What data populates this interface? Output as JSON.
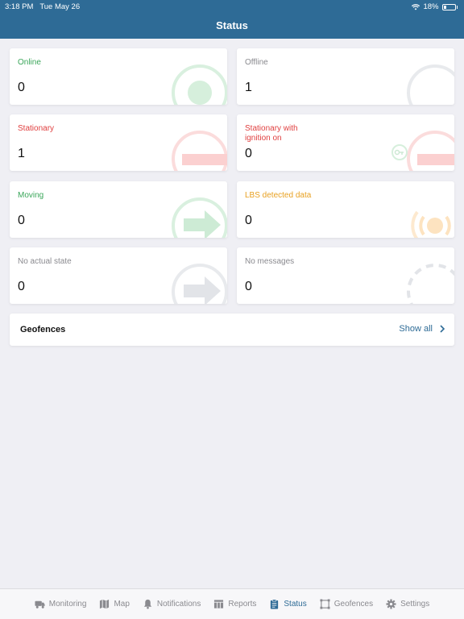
{
  "statusbar": {
    "time": "3:18 PM",
    "date": "Tue May 26",
    "battery": "18%"
  },
  "header": {
    "title": "Status"
  },
  "cards": [
    {
      "label": "Online",
      "value": "0",
      "color": "#3aa65a",
      "icon": "online-dot-icon"
    },
    {
      "label": "Offline",
      "value": "1",
      "color": "#8a8a8f",
      "icon": "offline-circle-icon"
    },
    {
      "label": "Stationary",
      "value": "1",
      "color": "#e04040",
      "icon": "stationary-bar-icon"
    },
    {
      "label": "Stationary with ignition on",
      "value": "0",
      "color": "#e04040",
      "icon": "ignition-key-icon"
    },
    {
      "label": "Moving",
      "value": "0",
      "color": "#3aa65a",
      "icon": "moving-arrow-icon"
    },
    {
      "label": "LBS detected data",
      "value": "0",
      "color": "#e8a020",
      "icon": "lbs-signal-icon"
    },
    {
      "label": "No actual state",
      "value": "0",
      "color": "#8a8a8f",
      "icon": "no-state-arrow-icon"
    },
    {
      "label": "No messages",
      "value": "0",
      "color": "#8a8a8f",
      "icon": "no-messages-dashed-icon"
    }
  ],
  "geofences": {
    "title": "Geofences",
    "show_all": "Show all"
  },
  "tabs": [
    {
      "label": "Monitoring",
      "icon": "truck-icon",
      "active": false
    },
    {
      "label": "Map",
      "icon": "map-icon",
      "active": false
    },
    {
      "label": "Notifications",
      "icon": "bell-icon",
      "active": false
    },
    {
      "label": "Reports",
      "icon": "table-icon",
      "active": false
    },
    {
      "label": "Status",
      "icon": "clipboard-icon",
      "active": true
    },
    {
      "label": "Geofences",
      "icon": "geofence-icon",
      "active": false
    },
    {
      "label": "Settings",
      "icon": "gear-icon",
      "active": false
    }
  ],
  "colors": {
    "header": "#2e6b96",
    "accent": "#2e6b96",
    "background": "#efeff4"
  }
}
